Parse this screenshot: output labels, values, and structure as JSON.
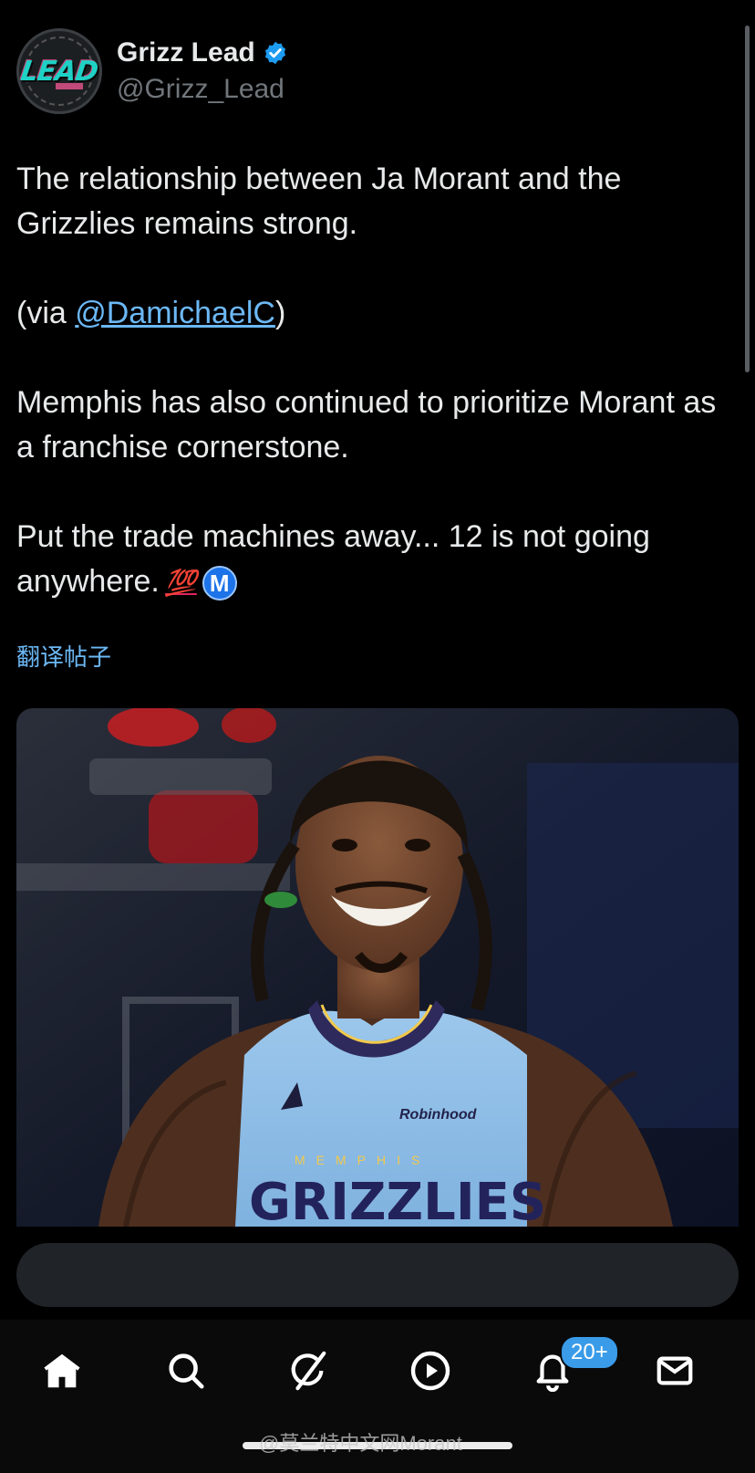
{
  "author": {
    "display_name": "Grizz Lead",
    "handle": "@Grizz_Lead",
    "avatar_text": "LEAD",
    "verified_icon": "verified-badge-icon"
  },
  "tweet": {
    "line1": "The relationship between Ja Morant and the Grizzlies remains strong.",
    "via_prefix": "(via ",
    "mention": "@DamichaelC",
    "via_suffix": ")",
    "line3": "Memphis has also continued to prioritize Morant as a franchise cornerstone.",
    "line4": "Put the trade machines away... 12 is not going anywhere.",
    "emoji_100": "💯",
    "badge_letter": "M"
  },
  "translate_label": "翻译帖子",
  "media": {
    "jersey_brand": "Robinhood",
    "jersey_city": "MEMPHIS",
    "jersey_team": "GRIZZLIES"
  },
  "reply": {
    "placeholder": ""
  },
  "nav": {
    "items": [
      "home-icon",
      "search-icon",
      "grok-icon",
      "play-icon",
      "bell-icon",
      "mail-icon"
    ],
    "notification_count": "20+"
  },
  "watermark": "@莫兰特中文网Morant",
  "colors": {
    "link": "#6cb8f5",
    "verified": "#1d9bf0",
    "badge": "#3a9be8",
    "background": "#000000"
  }
}
